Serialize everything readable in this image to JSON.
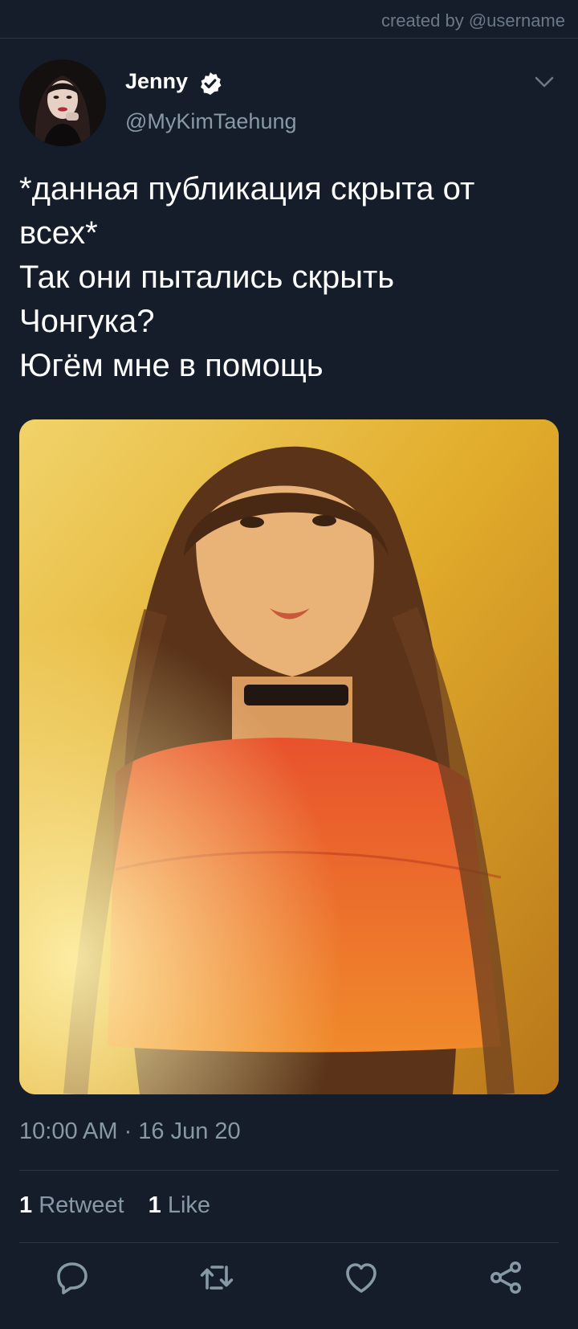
{
  "watermark": "created by @username",
  "tweet": {
    "author": {
      "display_name": "Jenny",
      "handle": "@MyKimTaehung",
      "verified": true
    },
    "text_lines": [
      "*данная публикация скрыта от",
      "всех*",
      "Так они пытались скрыть",
      "Чонгука?",
      "Югём мне в помощь"
    ],
    "timestamp": "10:00 AM · 16 Jun 20",
    "stats": {
      "retweets_count": "1",
      "retweets_label": "Retweet",
      "likes_count": "1",
      "likes_label": "Like"
    }
  },
  "icons": {
    "verified": "verified-badge-icon",
    "menu": "chevron-down-icon",
    "reply": "reply-icon",
    "retweet": "retweet-icon",
    "like": "heart-icon",
    "share": "share-icon"
  },
  "colors": {
    "background": "#151d2a",
    "secondary_text": "#8899a6",
    "divider": "#2b3645",
    "verified_badge": "#ffffff"
  }
}
